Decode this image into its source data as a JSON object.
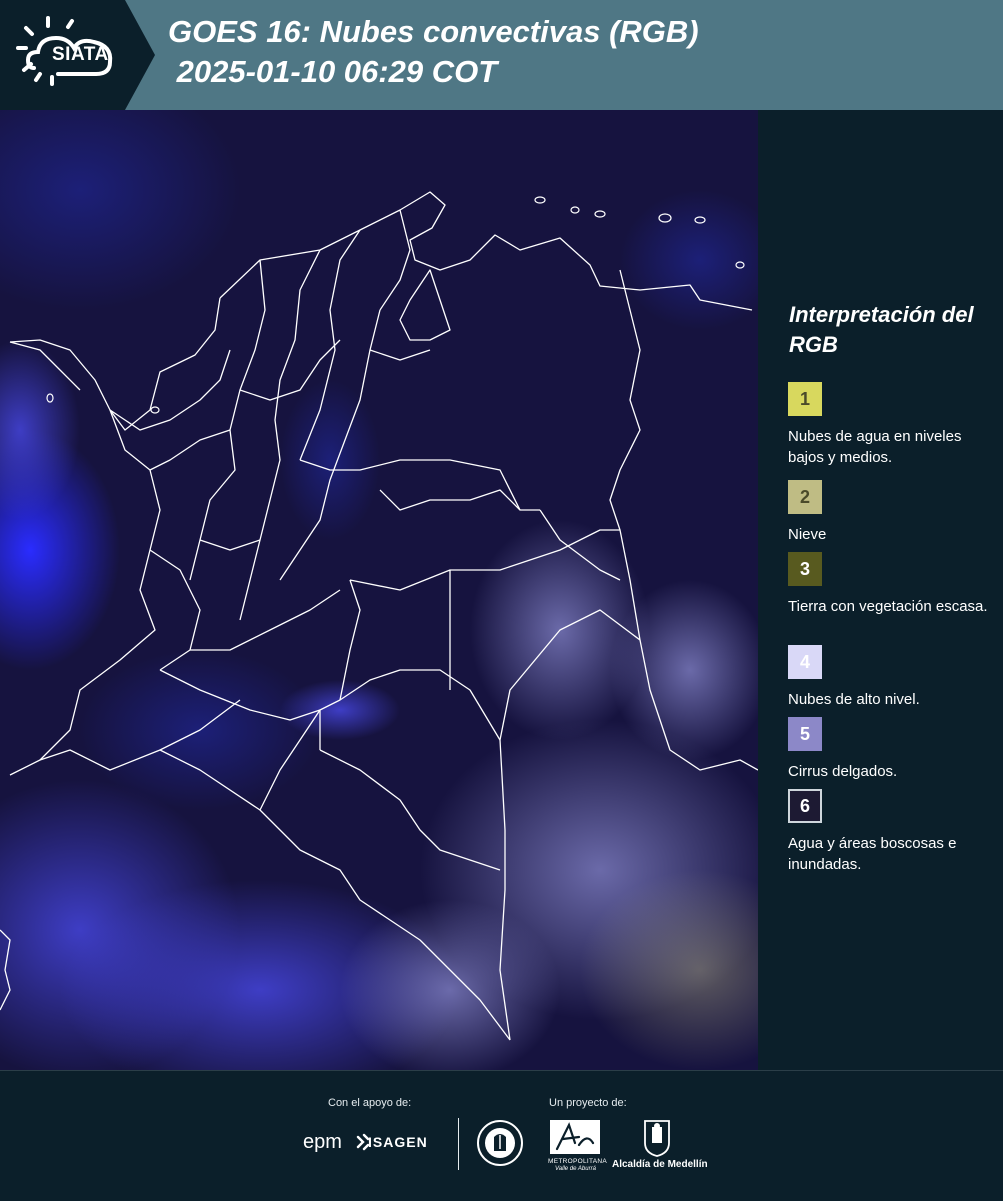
{
  "header": {
    "logo_text": "SIATA",
    "title_line1": "GOES 16: Nubes convectivas (RGB)",
    "title_line2": " 2025-01-10 06:29 COT"
  },
  "legend": {
    "title": "Interpretación del RGB",
    "items": [
      {
        "number": "1",
        "color": "#d8d85e",
        "label": "Nubes de agua en niveles bajos y medios."
      },
      {
        "number": "2",
        "color": "#bfbc84",
        "label": "Nieve"
      },
      {
        "number": "3",
        "color": "#585a1f",
        "label": "Tierra con vegetación escasa."
      },
      {
        "number": "4",
        "color": "#d9d8f7",
        "label": "Nubes de alto nivel."
      },
      {
        "number": "5",
        "color": "#8c88c8",
        "label": "Cirrus delgados."
      },
      {
        "number": "6",
        "color": "#1d1a33",
        "label": "Agua y áreas boscosas e inundadas."
      }
    ]
  },
  "footer": {
    "support_label": "Con el apoyo de:",
    "project_label": "Un proyecto de:",
    "sponsor1": "epm",
    "sponsor2": "ISAGEN",
    "partner_area_line1": "METROPOLITANA",
    "partner_area_line2": "Valle de Aburrá",
    "partner_alcaldia": "Alcaldía de Medellín"
  },
  "colors": {
    "header_bg": "#4f7785",
    "panel_bg": "#0b1f2a",
    "map_bg": "#15123f"
  }
}
